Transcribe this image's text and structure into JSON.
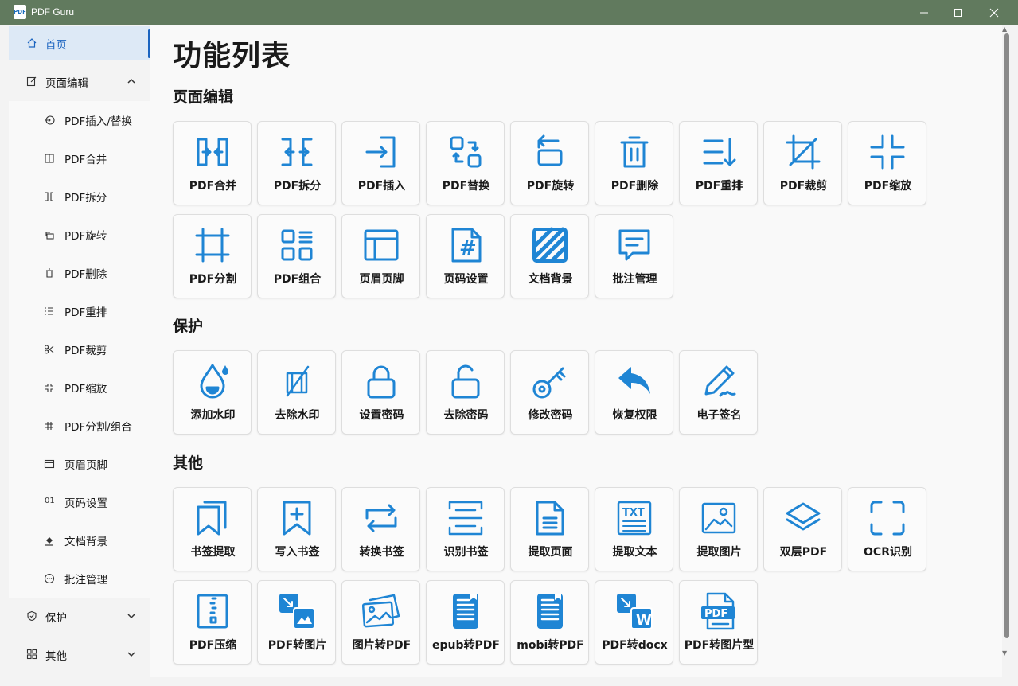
{
  "window": {
    "title": "PDF Guru",
    "app_icon_text": "PDF"
  },
  "sidebar": {
    "home": "首页",
    "page_edit": "页面编辑",
    "sub_items": [
      {
        "label": "PDF插入/替换",
        "icon": "insert-icon"
      },
      {
        "label": "PDF合并",
        "icon": "merge-icon"
      },
      {
        "label": "PDF拆分",
        "icon": "split-icon"
      },
      {
        "label": "PDF旋转",
        "icon": "rotate-icon"
      },
      {
        "label": "PDF删除",
        "icon": "trash-icon"
      },
      {
        "label": "PDF重排",
        "icon": "list-icon"
      },
      {
        "label": "PDF裁剪",
        "icon": "scissors-icon"
      },
      {
        "label": "PDF缩放",
        "icon": "shrink-icon"
      },
      {
        "label": "PDF分割/组合",
        "icon": "grid-icon"
      },
      {
        "label": "页眉页脚",
        "icon": "header-icon"
      },
      {
        "label": "页码设置",
        "icon": "01"
      },
      {
        "label": "文档背景",
        "icon": "fill-icon"
      },
      {
        "label": "批注管理",
        "icon": "comment-icon"
      }
    ],
    "protect": "保护",
    "other": "其他"
  },
  "main": {
    "title": "功能列表",
    "sections": {
      "edit": "页面编辑",
      "protect": "保护",
      "other": "其他"
    },
    "edit_tiles": [
      "PDF合并",
      "PDF拆分",
      "PDF插入",
      "PDF替换",
      "PDF旋转",
      "PDF删除",
      "PDF重排",
      "PDF裁剪",
      "PDF缩放",
      "PDF分割",
      "PDF组合",
      "页眉页脚",
      "页码设置",
      "文档背景",
      "批注管理"
    ],
    "protect_tiles": [
      "添加水印",
      "去除水印",
      "设置密码",
      "去除密码",
      "修改密码",
      "恢复权限",
      "电子签名"
    ],
    "other_tiles": [
      "书签提取",
      "写入书签",
      "转换书签",
      "识别书签",
      "提取页面",
      "提取文本",
      "提取图片",
      "双层PDF",
      "OCR识别",
      "PDF压缩",
      "PDF转图片",
      "图片转PDF",
      "epub转PDF",
      "mobi转PDF",
      "PDF转docx",
      "PDF转图片型"
    ],
    "icon_text": {
      "txt": "TXT",
      "pdf": "PDF",
      "word": "W",
      "page_number": "#"
    }
  },
  "colors": {
    "accent": "#1f85d4",
    "titlebar": "#617a5e",
    "active_nav": "#1b64c0"
  }
}
